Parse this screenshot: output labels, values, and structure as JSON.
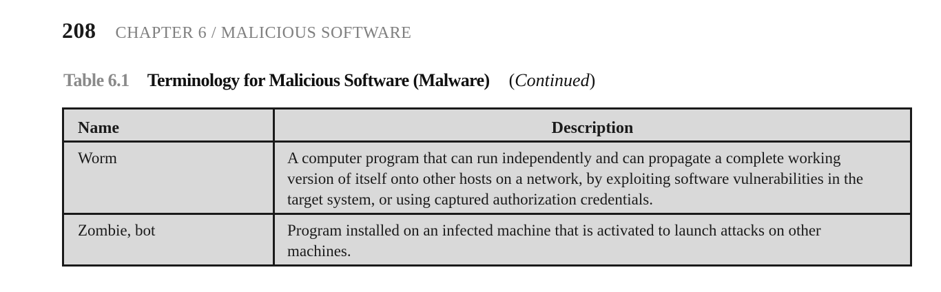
{
  "header": {
    "page_number": "208",
    "chapter": "CHAPTER 6 / MALICIOUS SOFTWARE"
  },
  "caption": {
    "number": "Table 6.1",
    "title": "Terminology for Malicious Software (Malware)",
    "continued_open": "(",
    "continued_word": "Continued",
    "continued_close": ")"
  },
  "table": {
    "headers": {
      "name": "Name",
      "description": "Description"
    },
    "rows": [
      {
        "name": "Worm",
        "description": "A computer program that can run independently and can propagate a complete working version of itself onto other hosts on a network, by exploiting software vulnerabilities in the target system, or using captured authorization credentials."
      },
      {
        "name": "Zombie, bot",
        "description": "Program installed on an infected machine that is activated to launch attacks on other machines."
      }
    ]
  }
}
